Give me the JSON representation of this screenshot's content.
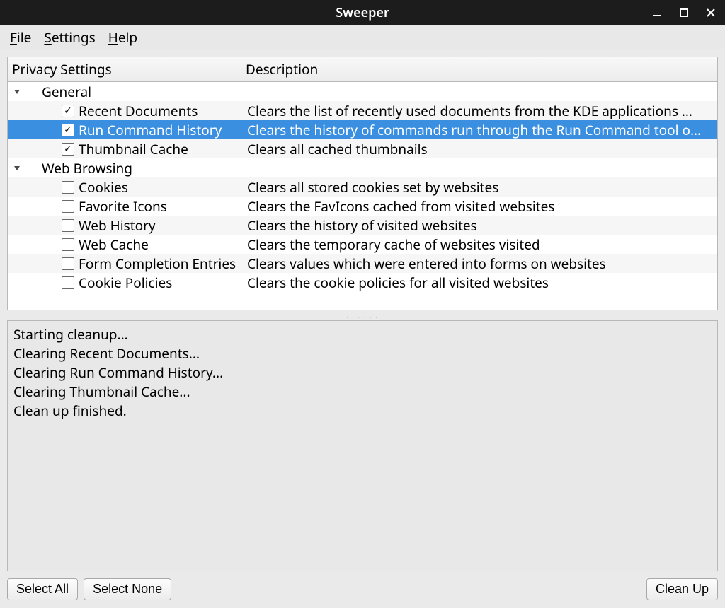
{
  "title": "Sweeper",
  "menu": {
    "file": "File",
    "settings": "Settings",
    "help": "Help"
  },
  "headers": {
    "col_a": "Privacy Settings",
    "col_b": "Description"
  },
  "groups": [
    {
      "label": "General",
      "items": [
        {
          "checked": true,
          "selected": false,
          "label": "Recent Documents",
          "desc": "Clears the list of recently used documents from the KDE applications …"
        },
        {
          "checked": true,
          "selected": true,
          "label": "Run Command History",
          "desc": "Clears the history of commands run through the Run Command tool o…"
        },
        {
          "checked": true,
          "selected": false,
          "label": "Thumbnail Cache",
          "desc": "Clears all cached thumbnails"
        }
      ]
    },
    {
      "label": "Web Browsing",
      "items": [
        {
          "checked": false,
          "selected": false,
          "label": "Cookies",
          "desc": "Clears all stored cookies set by websites"
        },
        {
          "checked": false,
          "selected": false,
          "label": "Favorite Icons",
          "desc": "Clears the FavIcons cached from visited websites"
        },
        {
          "checked": false,
          "selected": false,
          "label": "Web History",
          "desc": "Clears the history of visited websites"
        },
        {
          "checked": false,
          "selected": false,
          "label": "Web Cache",
          "desc": "Clears the temporary cache of websites visited"
        },
        {
          "checked": false,
          "selected": false,
          "label": "Form Completion Entries",
          "desc": "Clears values which were entered into forms on websites"
        },
        {
          "checked": false,
          "selected": false,
          "label": "Cookie Policies",
          "desc": "Clears the cookie policies for all visited websites"
        }
      ]
    }
  ],
  "log": [
    "Starting cleanup...",
    "Clearing Recent Documents...",
    "Clearing Run Command History...",
    "Clearing Thumbnail Cache...",
    "Clean up finished."
  ],
  "buttons": {
    "select_all": "Select All",
    "select_none": "Select None",
    "clean_up": "Clean Up"
  }
}
